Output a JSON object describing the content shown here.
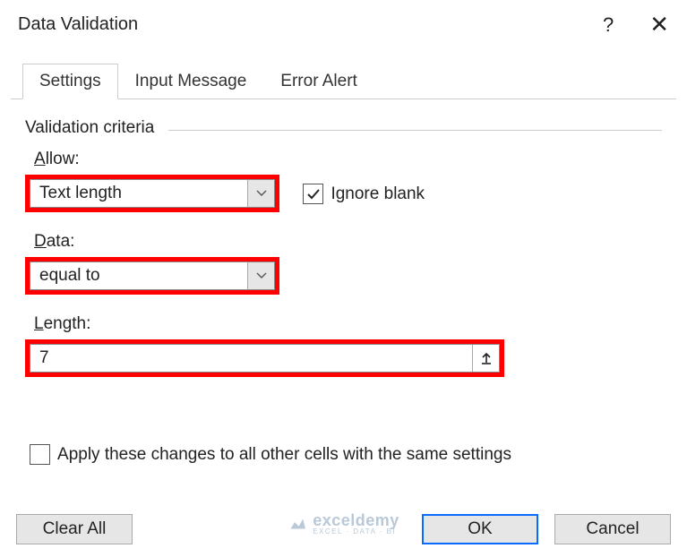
{
  "title": "Data Validation",
  "tabs": [
    "Settings",
    "Input Message",
    "Error Alert"
  ],
  "group_legend": "Validation criteria",
  "allow": {
    "label_pre": "",
    "label_ul": "A",
    "label_post": "llow:",
    "value": "Text length"
  },
  "ignore": {
    "label_pre": "Ignore ",
    "label_ul": "b",
    "label_post": "lank",
    "checked": true
  },
  "data": {
    "label_ul": "D",
    "label_post": "ata:",
    "value": "equal to"
  },
  "length": {
    "label_ul": "L",
    "label_post": "ength:",
    "value": "7"
  },
  "apply": {
    "label_ul": "P",
    "label_pre": "Apply these changes to all other cells with the same settings",
    "checked": false
  },
  "buttons": {
    "clear": "Clear All",
    "clear_ul": "C",
    "clear_post": "lear All",
    "ok": "OK",
    "cancel": "Cancel"
  },
  "watermark": {
    "name": "exceldemy",
    "sub": "EXCEL · DATA · BI"
  }
}
